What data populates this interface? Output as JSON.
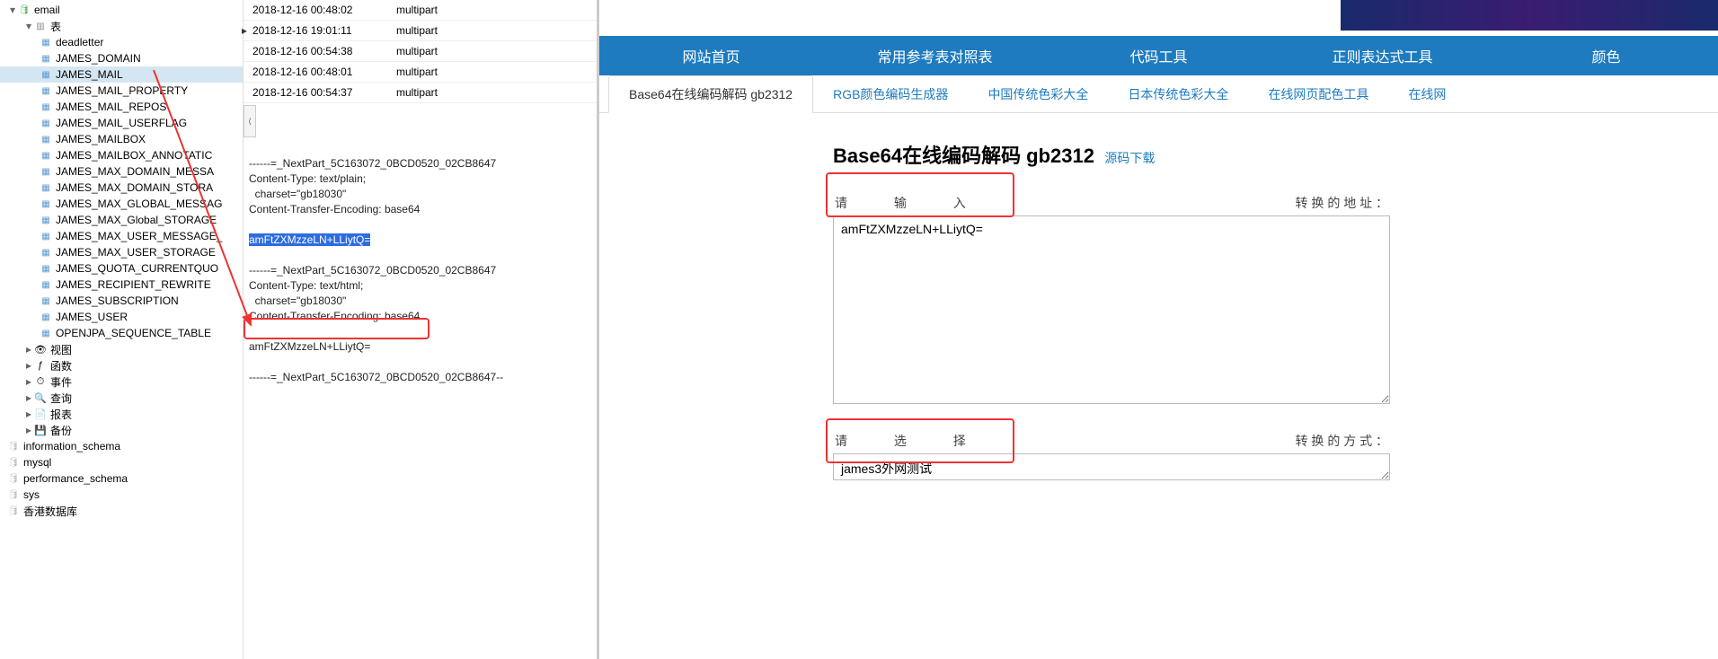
{
  "tree": {
    "root": "email",
    "tables_label": "表",
    "tables": [
      "deadletter",
      "JAMES_DOMAIN",
      "JAMES_MAIL",
      "JAMES_MAIL_PROPERTY",
      "JAMES_MAIL_REPOS",
      "JAMES_MAIL_USERFLAG",
      "JAMES_MAILBOX",
      "JAMES_MAILBOX_ANNOTATIC",
      "JAMES_MAX_DOMAIN_MESSA",
      "JAMES_MAX_DOMAIN_STORA",
      "JAMES_MAX_GLOBAL_MESSAG",
      "JAMES_MAX_Global_STORAGE",
      "JAMES_MAX_USER_MESSAGE_",
      "JAMES_MAX_USER_STORAGE",
      "JAMES_QUOTA_CURRENTQUO",
      "JAMES_RECIPIENT_REWRITE",
      "JAMES_SUBSCRIPTION",
      "JAMES_USER",
      "OPENJPA_SEQUENCE_TABLE"
    ],
    "selected": "JAMES_MAIL",
    "others": [
      {
        "icon": "👁",
        "label": "视图"
      },
      {
        "icon": "ƒ",
        "label": "函数"
      },
      {
        "icon": "⏱",
        "label": "事件"
      },
      {
        "icon": "🔍",
        "label": "查询"
      },
      {
        "icon": "📄",
        "label": "报表"
      },
      {
        "icon": "💾",
        "label": "备份"
      }
    ],
    "dbs": [
      "information_schema",
      "mysql",
      "performance_schema",
      "sys",
      "香港数据库"
    ]
  },
  "table_rows": [
    {
      "ts": "2018-12-16 00:48:02",
      "type": "multipart"
    },
    {
      "ts": "2018-12-16 19:01:11",
      "type": "multipart",
      "active": true
    },
    {
      "ts": "2018-12-16 00:54:38",
      "type": "multipart"
    },
    {
      "ts": "2018-12-16 00:48:01",
      "type": "multipart"
    },
    {
      "ts": "2018-12-16 00:54:37",
      "type": "multipart"
    }
  ],
  "mail_text": {
    "l1": "------=_NextPart_5C163072_0BCD0520_02CB8647",
    "l2": "Content-Type: text/plain;",
    "l3": "  charset=\"gb18030\"",
    "l4": "Content-Transfer-Encoding: base64",
    "l5": "amFtZXMzzeLN+LLiytQ=",
    "l6": "------=_NextPart_5C163072_0BCD0520_02CB8647",
    "l7": "Content-Type: text/html;",
    "l8": "  charset=\"gb18030\"",
    "l9": "Content-Transfer-Encoding: base64",
    "l10": "amFtZXMzzeLN+LLiytQ=",
    "l11": "------=_NextPart_5C163072_0BCD0520_02CB8647--"
  },
  "nav": [
    "网站首页",
    "常用参考表对照表",
    "代码工具",
    "正则表达式工具",
    "颜色"
  ],
  "subnav": [
    {
      "label": "Base64在线编码解码 gb2312",
      "active": true
    },
    {
      "label": "RGB颜色编码生成器"
    },
    {
      "label": "中国传统色彩大全"
    },
    {
      "label": "日本传统色彩大全"
    },
    {
      "label": "在线网页配色工具"
    },
    {
      "label": "在线网"
    }
  ],
  "page": {
    "title": "Base64在线编码解码 gb2312",
    "download": "源码下载",
    "ph1": "请输入转换的地址：",
    "ph1_spread": "请        输        入",
    "ph1_rest": "转        换        的        地        址        ：",
    "in1": "amFtZXMzzeLN+LLiytQ=",
    "ph2": "请        选        择",
    "ph2_rest": "转        换        的        方        式        ：",
    "in2": "james3外网测试",
    "watermark": ""
  }
}
